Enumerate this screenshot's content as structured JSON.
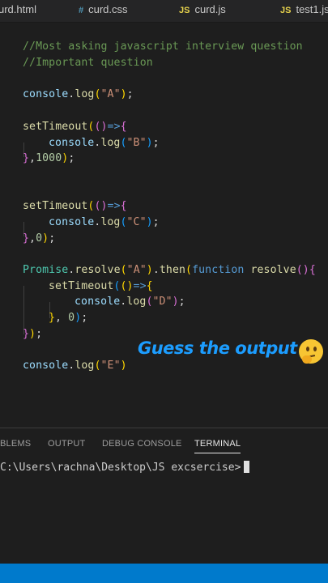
{
  "tabs": [
    {
      "icon": "",
      "label": "urd.html"
    },
    {
      "icon": "#",
      "label": "curd.css"
    },
    {
      "icon": "JS",
      "label": "curd.js"
    },
    {
      "icon": "JS",
      "label": "test1.js"
    }
  ],
  "code": {
    "comment1": "//Most asking javascript interview question",
    "comment2": "//Important question",
    "console": "console",
    "log": "log",
    "setTimeout": "setTimeout",
    "Promise": "Promise",
    "resolve": "resolve",
    "then": "then",
    "function": "function",
    "strA": "\"A\"",
    "strB": "\"B\"",
    "strC": "\"C\"",
    "strD": "\"D\"",
    "strE": "\"E\"",
    "n1000": "1000",
    "n0": "0"
  },
  "caption": "Guess the output",
  "panel": {
    "tabs": [
      "BLEMS",
      "OUTPUT",
      "DEBUG CONSOLE",
      "TERMINAL"
    ],
    "active_tab": "TERMINAL",
    "terminal_prompt": "C:\\Users\\rachna\\Desktop\\JS excsercise>"
  },
  "colors": {
    "accent": "#1c9dff",
    "status_bar": "#007acc",
    "editor_bg": "#1e1e1e"
  }
}
